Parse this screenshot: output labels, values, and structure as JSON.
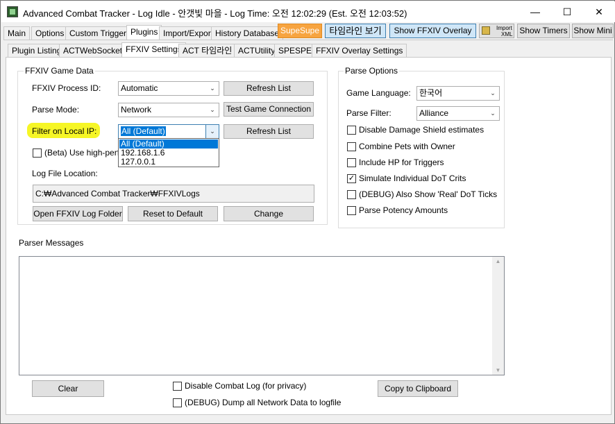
{
  "window": {
    "title": "Advanced Combat Tracker - Log Idle - 안갯빛 마을 - Log Time: 오전 12:02:29 (Est. 오전 12:03:52)",
    "minimize": "—",
    "maximize": "☐",
    "close": "✕"
  },
  "main_tabs": [
    "Main",
    "Options",
    "Custom Triggers",
    "Plugins",
    "Import/Export",
    "History Database"
  ],
  "toolbar": {
    "supesupe": "SupeSupe",
    "timeline": "타임라인 보기",
    "overlay": "Show FFXIV Overlay",
    "import_top": "Import",
    "import_bottom": "XML",
    "timers": "Show Timers",
    "mini": "Show Mini"
  },
  "plugin_tabs": [
    "Plugin Listing",
    "ACTWebSocket",
    "FFXIV Settings",
    "ACT 타임라인",
    "ACTUtility",
    "SPESPE",
    "FFXIV Overlay Settings"
  ],
  "game_data": {
    "group_label": "FFXIV Game Data",
    "process_label": "FFXIV Process ID:",
    "process_value": "Automatic",
    "refresh_list": "Refresh List",
    "parse_mode_label": "Parse Mode:",
    "parse_mode_value": "Network",
    "test_connection": "Test Game Connection",
    "local_ip_label": "Filter on Local IP:",
    "local_ip_value": "All (Default)",
    "refresh_list2": "Refresh List",
    "ip_options": [
      "All (Default)",
      "192.168.1.6",
      "127.0.0.1"
    ],
    "beta_label": "(Beta) Use high-perfo",
    "log_location_label": "Log File Location:",
    "log_path": "C:₩Advanced Combat Tracker₩FFXIVLogs",
    "open_folder": "Open FFXIV Log Folder",
    "reset_default": "Reset to Default",
    "change": "Change"
  },
  "parse_options": {
    "group_label": "Parse Options",
    "language_label": "Game Language:",
    "language_value": "한국어",
    "filter_label": "Parse Filter:",
    "filter_value": "Alliance",
    "checkboxes": [
      {
        "label": "Disable Damage Shield estimates",
        "checked": false
      },
      {
        "label": "Combine Pets with Owner",
        "checked": false
      },
      {
        "label": "Include HP for Triggers",
        "checked": false
      },
      {
        "label": "Simulate Individual DoT Crits",
        "checked": true
      },
      {
        "label": "(DEBUG) Also Show 'Real' DoT Ticks",
        "checked": false
      },
      {
        "label": "Parse Potency Amounts",
        "checked": false
      }
    ],
    "check_mark": "✓"
  },
  "parser_messages": {
    "label": "Parser Messages",
    "clear": "Clear",
    "disable_log": "Disable Combat Log (for privacy)",
    "dump_network": "(DEBUG) Dump all Network Data to logfile",
    "copy": "Copy to Clipboard",
    "scroll_up": "▲",
    "scroll_down": "▼"
  },
  "dropdown_arrow": "⌄",
  "highlight_color": "#f5f500"
}
